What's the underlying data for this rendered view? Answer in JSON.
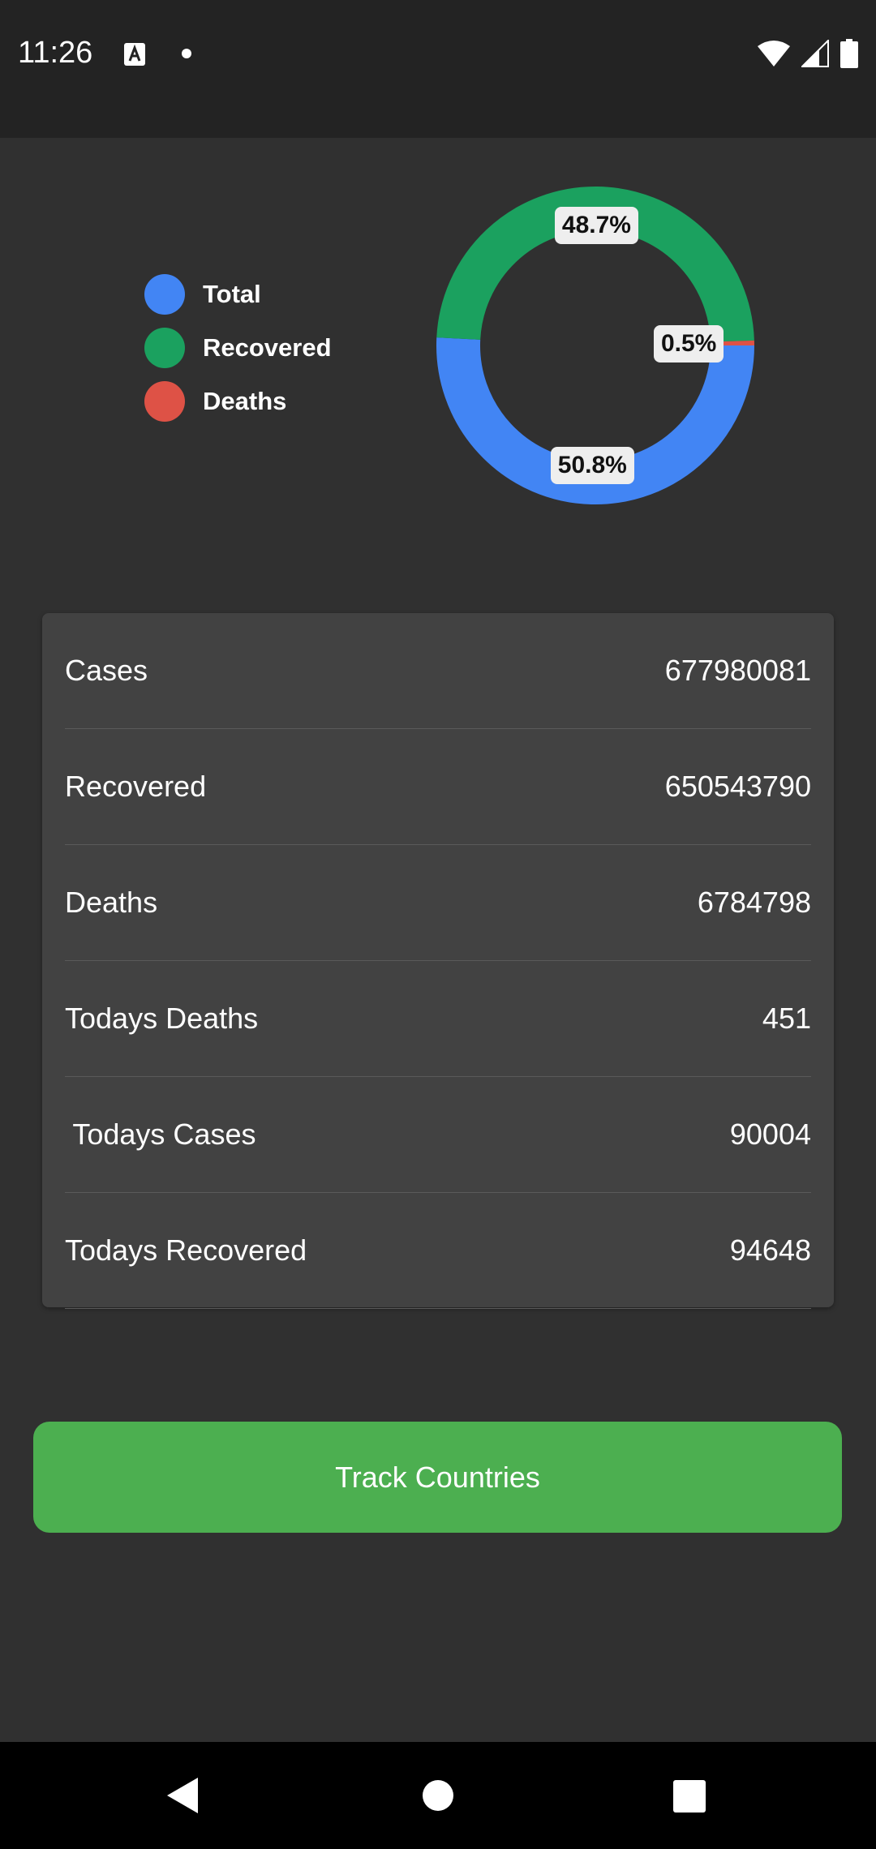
{
  "status_bar": {
    "time": "11:26"
  },
  "legend": [
    {
      "label": "Total",
      "color": "#4285f4"
    },
    {
      "label": "Recovered",
      "color": "#1ba15f"
    },
    {
      "label": "Deaths",
      "color": "#de5246"
    }
  ],
  "chart_data": {
    "type": "pie",
    "labels": [
      "Total",
      "Recovered",
      "Deaths"
    ],
    "values": [
      50.8,
      48.7,
      0.5
    ],
    "value_labels": [
      "50.8%",
      "48.7%",
      "0.5%"
    ],
    "colors": [
      "#4285f4",
      "#1ba15f",
      "#de5246"
    ],
    "legend_position": "left"
  },
  "stats": [
    {
      "label": "Cases",
      "value": "677980081"
    },
    {
      "label": "Recovered",
      "value": "650543790"
    },
    {
      "label": "Deaths",
      "value": "6784798"
    },
    {
      "label": "Todays Deaths",
      "value": "451"
    },
    {
      "label": " Todays Cases",
      "value": "90004"
    },
    {
      "label": "Todays Recovered",
      "value": "94648"
    }
  ],
  "track_button": {
    "label": "Track Countries"
  }
}
